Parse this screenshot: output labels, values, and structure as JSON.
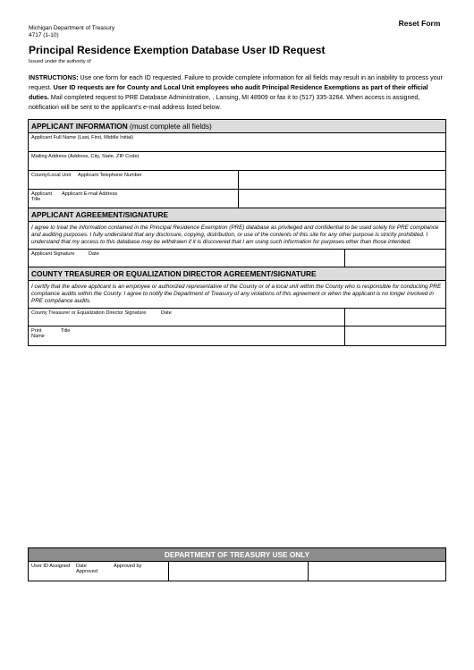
{
  "reset_button": "Reset Form",
  "header": {
    "department": "Michigan Department of Treasury",
    "form_number": "4717 (1-10)",
    "title": "Principal Residence Exemption Database User ID Request",
    "authority": "Issued under the authority of"
  },
  "instructions": {
    "label": "INSTRUCTIONS:",
    "text1": " Use one form for each ID requested.  Failure to provide complete information for all fields may result in an inability to process your request. ",
    "bold_text": "User ID requests are for County and Local Unit employees who audit Principal Residence Exemptions as part of their official duties.",
    "text2": " Mail completed request to PRE Database Administration,   , Lansing, MI 48909 or fax it to (517) 335-3264.  When access is assigned, notification will be sent to the applicant’s e-mail address listed below."
  },
  "applicant_info": {
    "heading": "APPLICANT INFORMATION",
    "heading_note": " (must complete all fields)",
    "full_name": "Applicant Full Name (Last, First, Middle Initial)",
    "mailing_address": "Mailing Address (Address, City, State, ZIP Code)",
    "county_unit": "County/Local Unit",
    "telephone": "Applicant Telephone Number",
    "applicant_title": "Applicant Title",
    "email": "Applicant E-mail Address"
  },
  "agreement": {
    "heading": "APPLICANT AGREEMENT/SIGNATURE",
    "text": "I agree to treat the information contained in the Principal Residence Exemption (PRE) database as privileged and confidential to be used solely for PRE compliance and auditing purposes.  I fully understand that any disclosure, copying, distribution, or use of the contents of this site for any other purpose is strictly prohibited.  I understand that my access to this database may be withdrawn if it is discovered that I am using such information for purposes other than those intended.",
    "signature": "Applicant Signature",
    "date": "Date"
  },
  "county": {
    "heading": "COUNTY TREASURER OR EQUALIZATION DIRECTOR AGREEMENT/SIGNATURE",
    "text": "I certify that the above applicant is an employee or authorized representative of the County or of a local unit within the County who is responsible for conducting PRE compliance audits within the County.  I agree to notify the Department of Treasury of any violations of this agreement or when the applicant is no longer involved in PRE compliance audits.",
    "signature": "County Treasurer or Equalization Director Signature",
    "date": "Date",
    "print_name": "Print Name",
    "title": "Title"
  },
  "treasury": {
    "heading": "DEPARTMENT OF TREASURY USE ONLY",
    "user_id": "User ID Assigned",
    "date_approved": "Date Approved",
    "approved_by": "Approved by"
  }
}
